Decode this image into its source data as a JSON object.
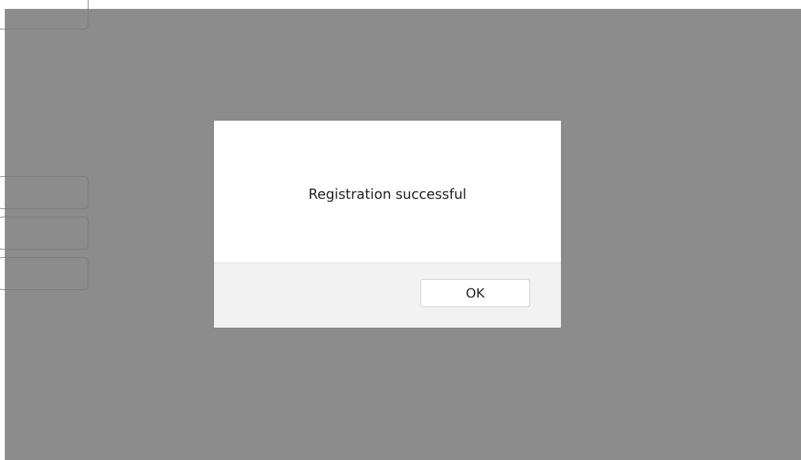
{
  "dialog": {
    "message": "Registration successful",
    "ok_label": "OK"
  },
  "colors": {
    "overlay": "#8c8c8c",
    "dialog_background": "#ffffff",
    "footer_background": "#f2f2f2"
  }
}
